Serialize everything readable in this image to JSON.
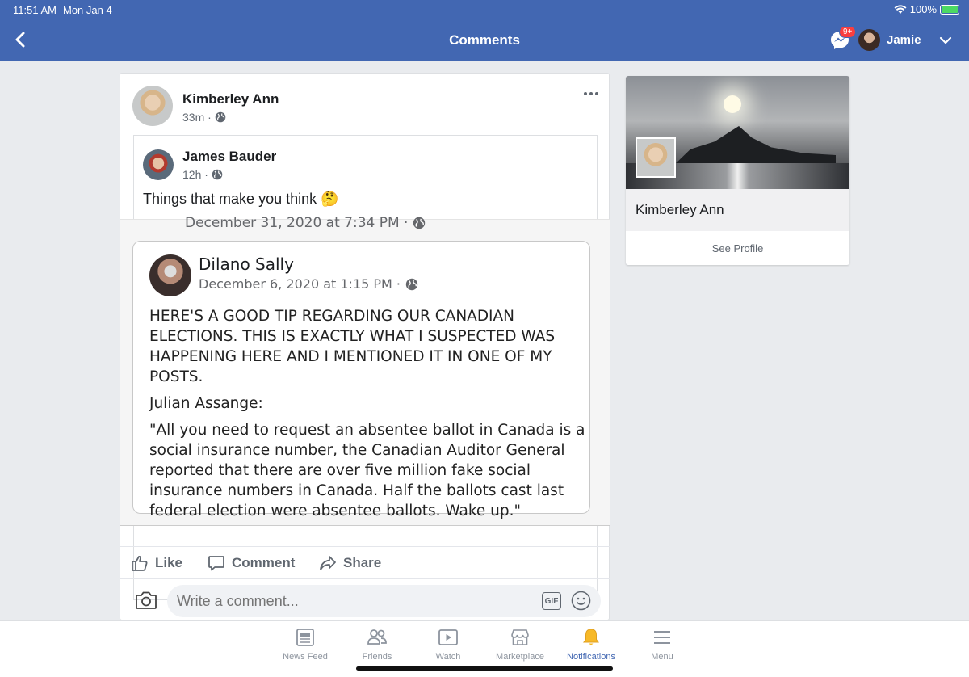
{
  "status": {
    "time": "11:51 AM",
    "date": "Mon Jan 4",
    "battery": "100%"
  },
  "header": {
    "title": "Comments",
    "badge": "9+",
    "user": "Jamie"
  },
  "post": {
    "author": "Kimberley Ann",
    "time": "33m ·",
    "shared": {
      "author": "James Bauder",
      "time": "12h ·",
      "text": "Things that make you think 🤔",
      "photo": {
        "date_line": "December 31, 2020 at 7:34 PM ·",
        "inner_author": "Dilano Sally",
        "inner_date": "December 6, 2020 at 1:15 PM ·",
        "para1": "HERE'S A GOOD TIP REGARDING OUR CANADIAN ELECTIONS. THIS IS EXACTLY WHAT I SUSPECTED WAS HAPPENING HERE AND I MENTIONED IT IN ONE OF MY POSTS.",
        "para2": "Julian Assange:",
        "para3": "\"All you need to request an absentee ballot in Canada is a social insurance number, the Canadian Auditor General reported that there are over five million fake social insurance numbers in Canada. Half the ballots cast last federal election were absentee ballots. Wake up.\""
      }
    },
    "actions": {
      "like": "Like",
      "comment": "Comment",
      "share": "Share"
    },
    "comment_placeholder": "Write a comment...",
    "gif": "GIF"
  },
  "profile_card": {
    "name": "Kimberley Ann",
    "see_profile": "See Profile"
  },
  "tabs": [
    {
      "label": "News Feed",
      "icon": "news-feed-icon"
    },
    {
      "label": "Friends",
      "icon": "friends-icon"
    },
    {
      "label": "Watch",
      "icon": "watch-icon"
    },
    {
      "label": "Marketplace",
      "icon": "marketplace-icon"
    },
    {
      "label": "Notifications",
      "icon": "bell-icon",
      "active": true
    },
    {
      "label": "Menu",
      "icon": "menu-icon"
    }
  ],
  "colors": {
    "brand": "#4267b2",
    "badge": "#fa3e3e",
    "muted": "#606770"
  }
}
